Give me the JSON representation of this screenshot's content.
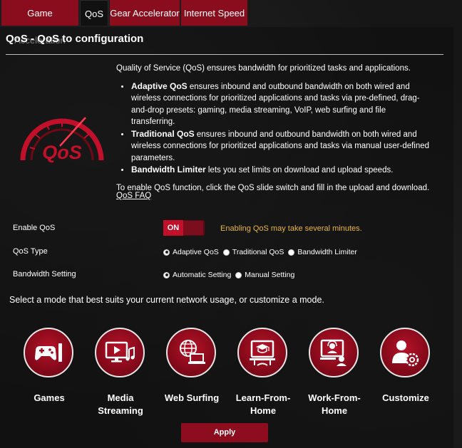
{
  "tabs": [
    {
      "label": "Game Acceleration"
    },
    {
      "label": "QoS"
    },
    {
      "label": "Gear Accelerator"
    },
    {
      "label": "Internet Speed"
    }
  ],
  "page_title": "QoS - QoS to configuration",
  "intro": "Quality of Service (QoS) ensures bandwidth for prioritized tasks and applications.",
  "bullets": [
    {
      "term": "Adaptive QoS",
      "text": " ensures inbound and outbound bandwidth on both wired and wireless connections for prioritized applications and tasks via pre-defined, drag-and-drop presets: gaming, media streaming, VoIP, web surfing and file transferring."
    },
    {
      "term": "Traditional QoS",
      "text": " ensures inbound and outbound bandwidth on both wired and wireless connections for prioritized applications and tasks via manual user-defined parameters."
    },
    {
      "term": "Bandwidth Limiter",
      "text": " lets you set limits on download and upload speeds."
    }
  ],
  "enable_note": "To enable QoS function, click the QoS slide switch and fill in the upload and download.",
  "faq_link": "QoS FAQ",
  "logo_text": "QoS",
  "settings": {
    "enable": {
      "label": "Enable QoS",
      "toggle": "ON",
      "warning": "Enabling QoS may take several minutes."
    },
    "type": {
      "label": "QoS Type",
      "options": [
        "Adaptive QoS",
        "Traditional QoS",
        "Bandwidth Limiter"
      ],
      "selected": "Adaptive QoS"
    },
    "bandwidth": {
      "label": "Bandwidth Setting",
      "options": [
        "Automatic Setting",
        "Manual Setting"
      ],
      "selected": "Automatic Setting"
    }
  },
  "select_mode": "Select a mode that best suits your current network usage, or customize a mode.",
  "modes": [
    {
      "label": "Games",
      "icon": "gamepad-icon"
    },
    {
      "label": "Media Streaming",
      "icon": "media-icon"
    },
    {
      "label": "Web Surfing",
      "icon": "globe-laptop-icon"
    },
    {
      "label": "Learn-From-Home",
      "icon": "learning-icon"
    },
    {
      "label": "Work-From-Home",
      "icon": "headset-icon"
    },
    {
      "label": "Customize",
      "icon": "user-gear-icon"
    }
  ],
  "apply_label": "Apply",
  "colors": {
    "accent": "#8a0d1d",
    "warning": "#e9b63c",
    "background": "#161616"
  }
}
